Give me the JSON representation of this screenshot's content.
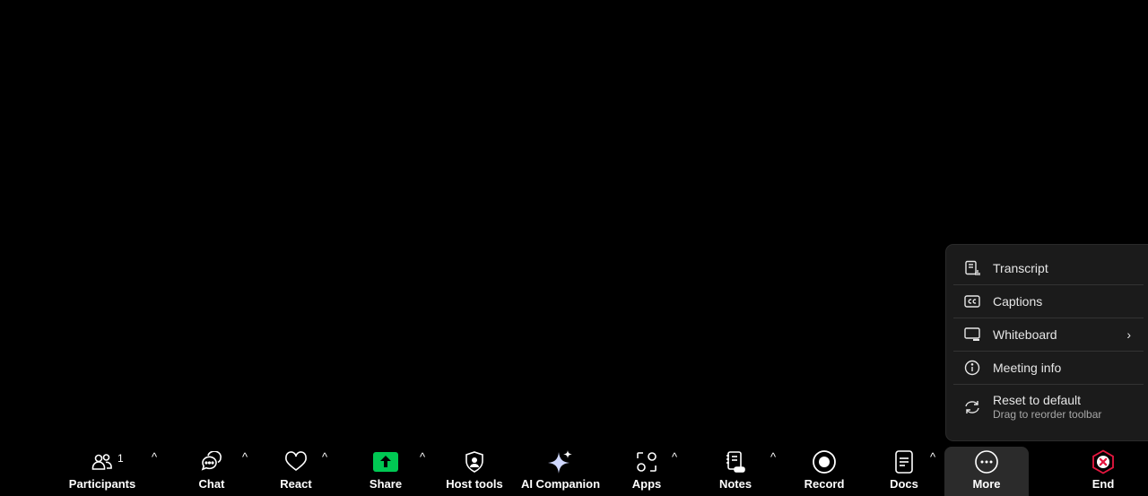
{
  "more_menu": {
    "items": [
      {
        "label": "Transcript",
        "icon": "transcript-icon"
      },
      {
        "label": "Captions",
        "icon": "captions-icon"
      },
      {
        "label": "Whiteboard",
        "icon": "whiteboard-icon",
        "chevron": "›"
      },
      {
        "label": "Meeting info",
        "icon": "info-icon"
      }
    ],
    "reset": {
      "label": "Reset to default",
      "hint": "Drag to reorder toolbar",
      "icon": "reset-icon"
    }
  },
  "toolbar": {
    "participants": {
      "label": "Participants",
      "count": "1"
    },
    "chat": {
      "label": "Chat"
    },
    "react": {
      "label": "React"
    },
    "share": {
      "label": "Share"
    },
    "host_tools": {
      "label": "Host tools"
    },
    "ai_companion": {
      "label": "AI Companion"
    },
    "apps": {
      "label": "Apps"
    },
    "notes": {
      "label": "Notes"
    },
    "record": {
      "label": "Record"
    },
    "docs": {
      "label": "Docs"
    },
    "more": {
      "label": "More"
    },
    "end": {
      "label": "End"
    },
    "caret": "^"
  },
  "colors": {
    "share_accent": "#00c853",
    "end_accent": "#e5173f",
    "background": "#000000",
    "menu_bg": "#1b1b1b"
  }
}
